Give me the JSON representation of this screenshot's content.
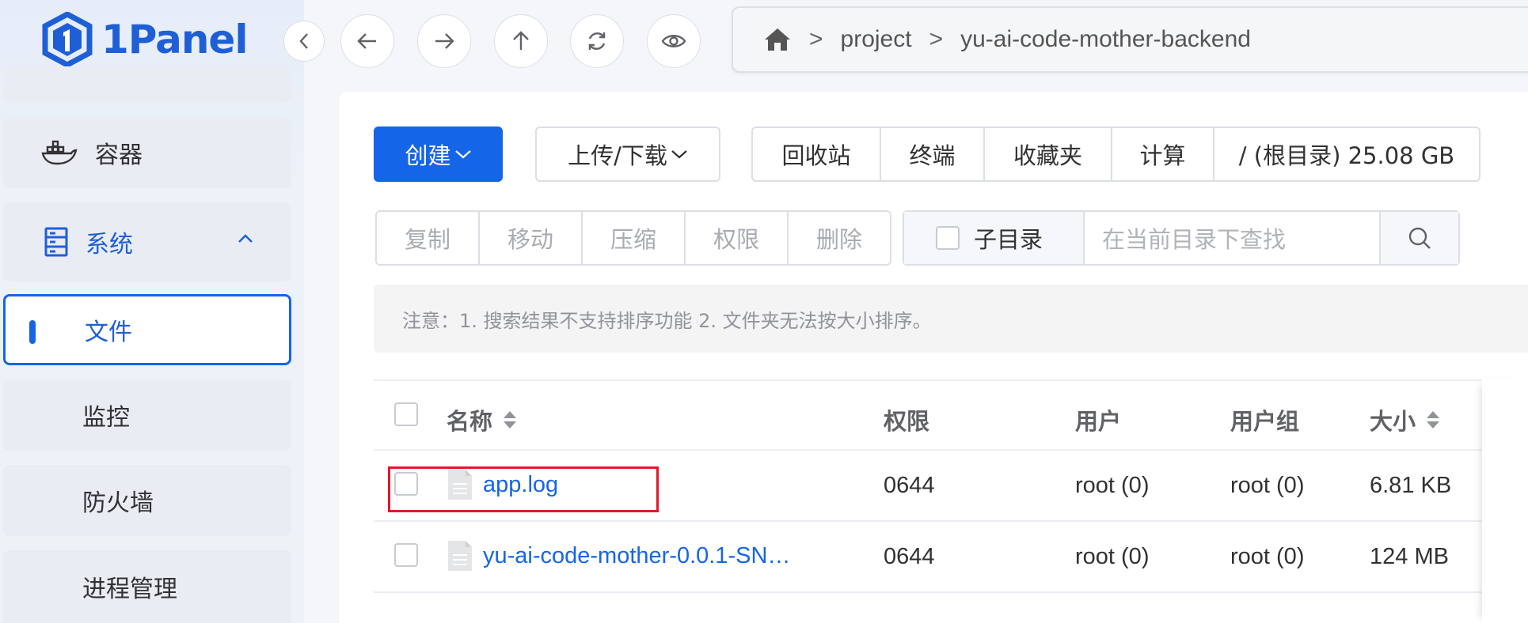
{
  "app": {
    "logo_text": "1Panel"
  },
  "sidebar": {
    "items": [
      {
        "label": "容器",
        "icon": "docker-icon"
      },
      {
        "label": "系统",
        "icon": "server-icon",
        "expanded": true
      },
      {
        "label": "文件",
        "active": true
      },
      {
        "label": "监控"
      },
      {
        "label": "防火墙"
      },
      {
        "label": "进程管理"
      }
    ]
  },
  "breadcrumb": {
    "home_icon": "home-icon",
    "items": [
      "project",
      "yu-ai-code-mother-backend"
    ],
    "separator": ">"
  },
  "toolbar": {
    "create_label": "创建",
    "upload_label": "上传/下载",
    "recycle_label": "回收站",
    "terminal_label": "终端",
    "favorites_label": "收藏夹",
    "calculate_label": "计算",
    "disk_label": "/ (根目录) 25.08 GB"
  },
  "actions": {
    "copy_label": "复制",
    "move_label": "移动",
    "compress_label": "压缩",
    "permission_label": "权限",
    "delete_label": "删除"
  },
  "search": {
    "subdir_label": "子目录",
    "placeholder": "在当前目录下查找"
  },
  "notice": {
    "text": "注意：1. 搜索结果不支持排序功能 2. 文件夹无法按大小排序。"
  },
  "table": {
    "headers": {
      "name": "名称",
      "permission": "权限",
      "user": "用户",
      "group": "用户组",
      "size": "大小"
    },
    "rows": [
      {
        "name": "app.log",
        "permission": "0644",
        "user": "root (0)",
        "group": "root (0)",
        "size": "6.81 KB"
      },
      {
        "name": "yu-ai-code-mother-0.0.1-SN…",
        "permission": "0644",
        "user": "root (0)",
        "group": "root (0)",
        "size": "124 MB"
      }
    ]
  },
  "colors": {
    "accent": "#1565e8",
    "highlight": "#e0182b"
  }
}
